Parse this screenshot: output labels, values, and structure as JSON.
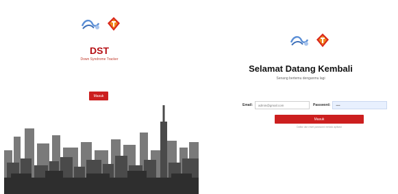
{
  "left_panel": {
    "title": "DST",
    "subtitle": "Down Syndrome Tracker",
    "button_label": "Masuk"
  },
  "right_panel": {
    "heading": "Selamat Datang Kembali",
    "subheading": "Senang bertemu denganmu lagi",
    "email_label": "Email:",
    "email_value": "admin@gmail.com",
    "password_label": "Password:",
    "password_value": "••••",
    "submit_label": "Masuk",
    "hint": "Daftar dan reset password melalui aplikasi"
  },
  "colors": {
    "brand_red": "#cc1f1f",
    "logo_blue": "#5b8fd6",
    "skyline_dark": "#3a3a3a",
    "skyline_mid": "#6e6e6e"
  },
  "icons": [
    "logo-wave-icon",
    "logo-mascot-icon"
  ]
}
